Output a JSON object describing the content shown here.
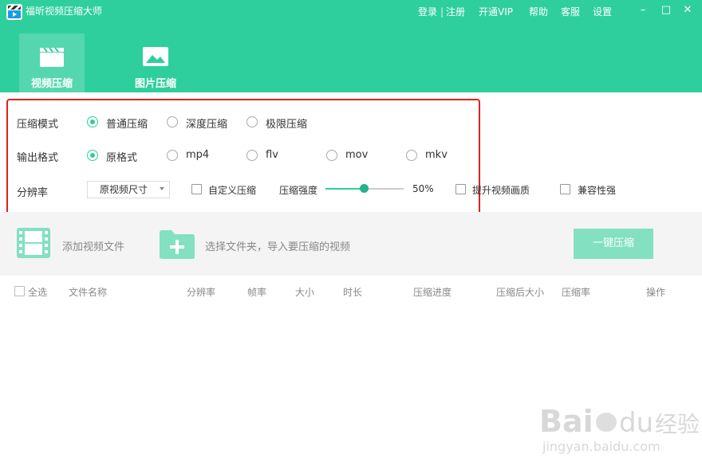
{
  "window": {
    "title": "福昕视频压缩大师"
  },
  "top_links": {
    "login": "登录",
    "separator": "|",
    "register": "注册",
    "vip": "开通VIP",
    "help": "帮助",
    "service": "客服",
    "settings": "设置"
  },
  "window_controls": {
    "minimize": "–",
    "restore": "□",
    "close": "✕"
  },
  "main_tabs": [
    {
      "label": "视频压缩",
      "icon": "clapperboard-icon",
      "active": true
    },
    {
      "label": "图片压缩",
      "icon": "image-icon",
      "active": false
    }
  ],
  "compression_mode": {
    "label": "压缩模式",
    "options": [
      "普通压缩",
      "深度压缩",
      "极限压缩"
    ],
    "selected": "普通压缩"
  },
  "output_format": {
    "label": "输出格式",
    "options": [
      "原格式",
      "mp4",
      "flv",
      "mov",
      "mkv"
    ],
    "selected": "原格式"
  },
  "resolution": {
    "label": "分辨率",
    "select_value": "原视频尺寸",
    "custom_compress_label": "自定义压缩",
    "strength_label": "压缩强度",
    "strength_value": "50%",
    "strength_fraction": 0.5,
    "enhance_quality_label": "提升视频画质",
    "compatibility_label": "兼容性强"
  },
  "actions": {
    "add_file": "添加视频文件",
    "add_folder": "选择文件夹，导入要压缩的视频",
    "compress_all": "一键压缩"
  },
  "table": {
    "select_all": "全选",
    "columns": [
      "文件名称",
      "分辨率",
      "帧率",
      "大小",
      "时长",
      "压缩进度",
      "压缩后大小",
      "压缩率",
      "操作"
    ]
  },
  "colors": {
    "accent": "#2fcf9d",
    "highlight": "#e02020",
    "button_light": "#83e0c1"
  }
}
